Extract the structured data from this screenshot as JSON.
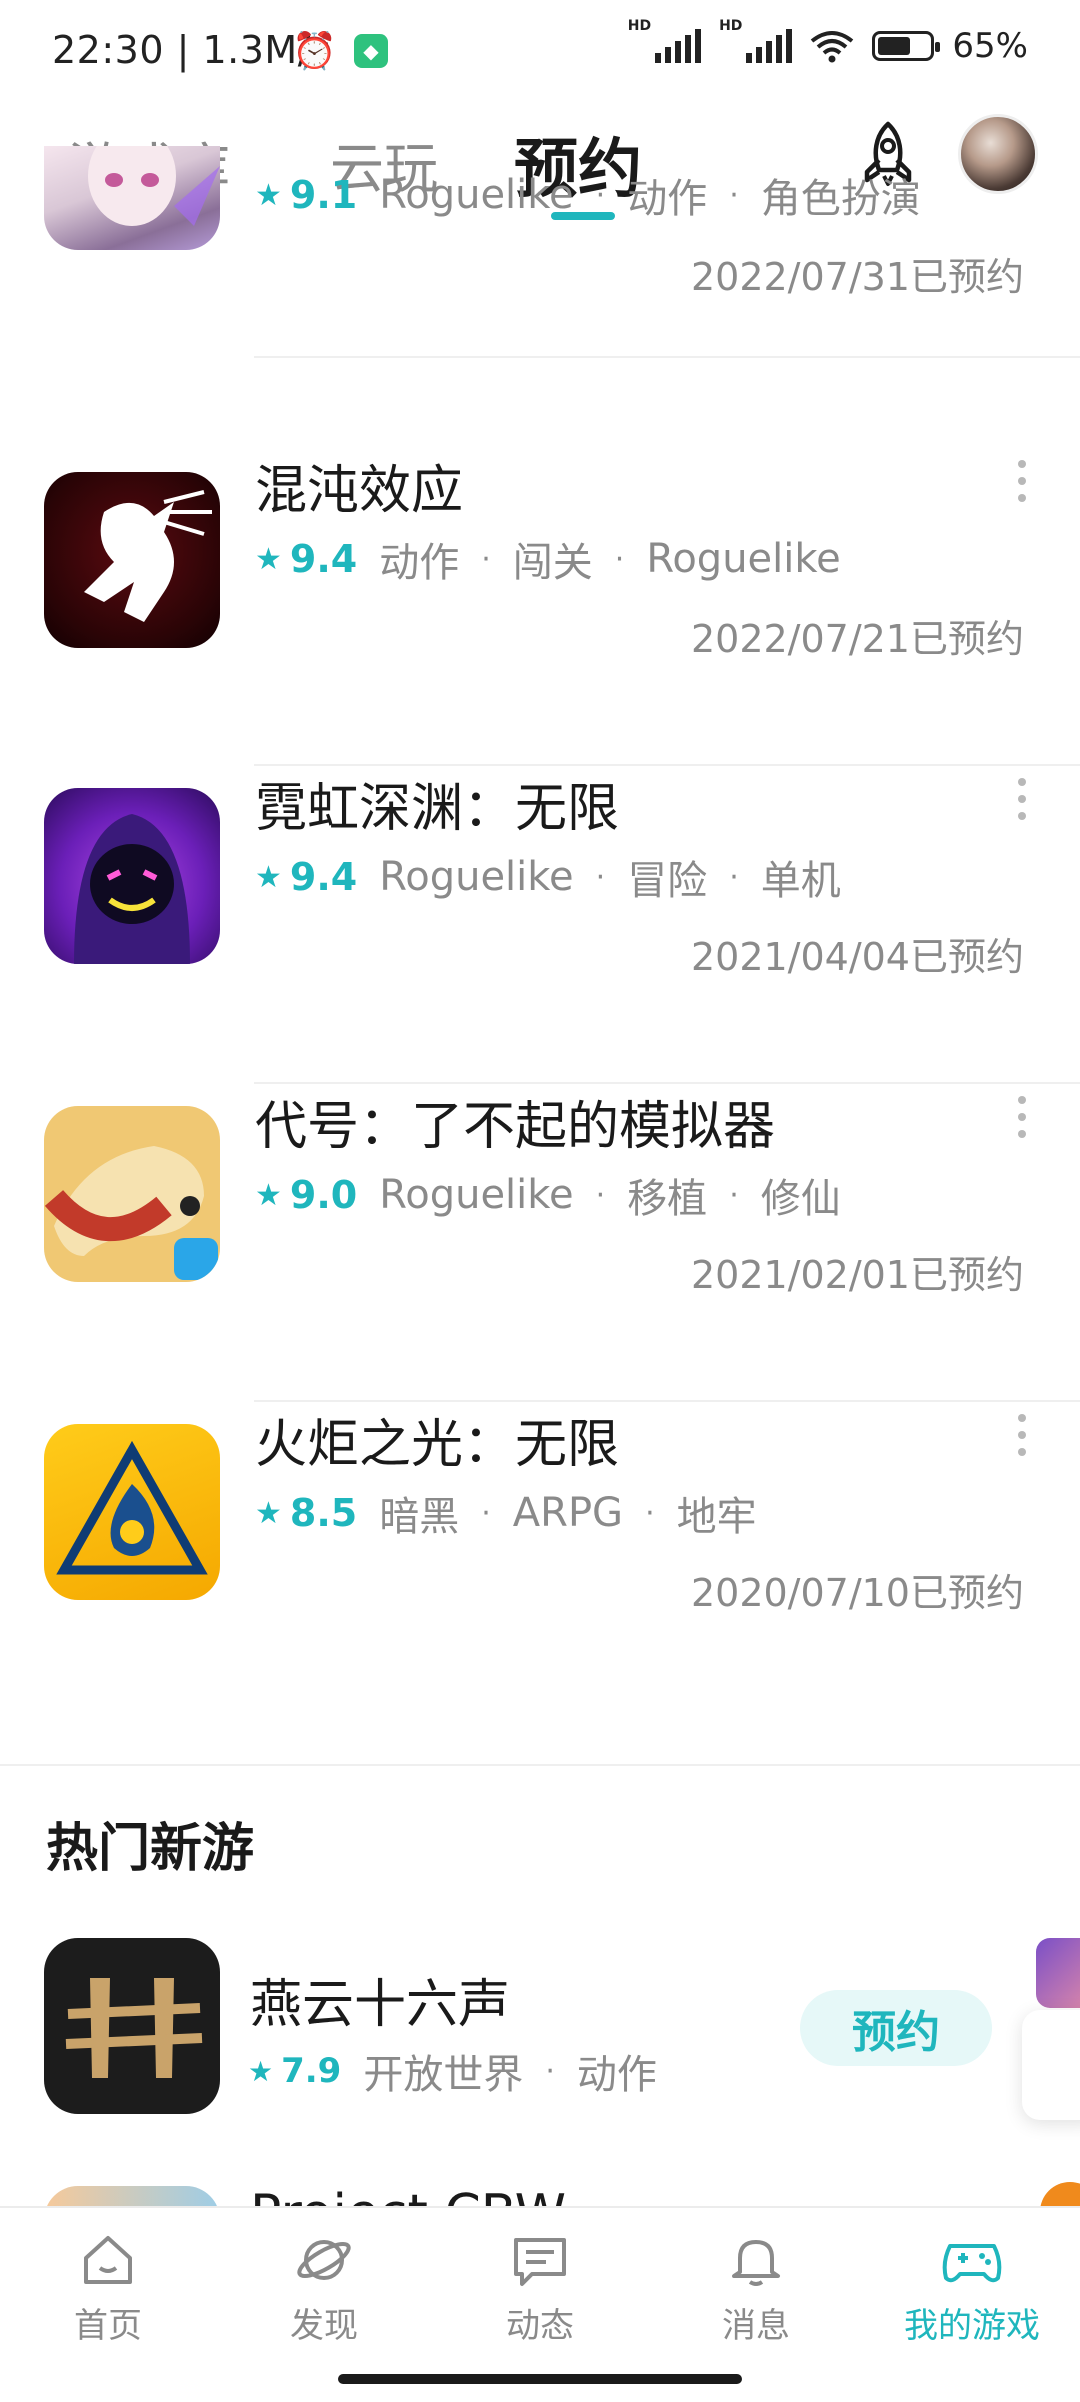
{
  "status_bar": {
    "time": "22:30 | 1.3M/s",
    "battery": "65%",
    "battery_level": 0.65
  },
  "top_tabs": [
    {
      "label": "游戏库",
      "active": false
    },
    {
      "label": "云玩",
      "active": false
    },
    {
      "label": "预约",
      "active": true
    }
  ],
  "reserved_games": [
    {
      "title": "",
      "rating": "9.1",
      "tags": [
        "Roguelike",
        "动作",
        "角色扮演"
      ],
      "date": "2022/07/31已预约"
    },
    {
      "title": "混沌效应",
      "rating": "9.4",
      "tags": [
        "动作",
        "闯关",
        "Roguelike"
      ],
      "date": "2022/07/21已预约"
    },
    {
      "title": "霓虹深渊：无限",
      "rating": "9.4",
      "tags": [
        "Roguelike",
        "冒险",
        "单机"
      ],
      "date": "2021/04/04已预约"
    },
    {
      "title": "代号：了不起的模拟器",
      "rating": "9.0",
      "tags": [
        "Roguelike",
        "移植",
        "修仙"
      ],
      "date": "2021/02/01已预约"
    },
    {
      "title": "火炬之光：无限",
      "rating": "8.5",
      "tags": [
        "暗黑",
        "ARPG",
        "地牢"
      ],
      "date": "2020/07/10已预约"
    }
  ],
  "hot_section": {
    "title": "热门新游",
    "games": [
      {
        "title": "燕云十六声",
        "rating": "7.9",
        "tags": [
          "开放世界",
          "动作"
        ],
        "button": "预约"
      },
      {
        "title": "Project CBW"
      }
    ]
  },
  "bottom_nav": [
    {
      "label": "首页",
      "icon": "home-icon",
      "active": false
    },
    {
      "label": "发现",
      "icon": "planet-icon",
      "active": false
    },
    {
      "label": "动态",
      "icon": "chat-icon",
      "active": false
    },
    {
      "label": "消息",
      "icon": "bell-icon",
      "active": false
    },
    {
      "label": "我的游戏",
      "icon": "gamepad-icon",
      "active": true
    }
  ],
  "colors": {
    "accent": "#1fb6bd",
    "text_primary": "#1a1a1a",
    "text_secondary": "#8a8a8a"
  }
}
